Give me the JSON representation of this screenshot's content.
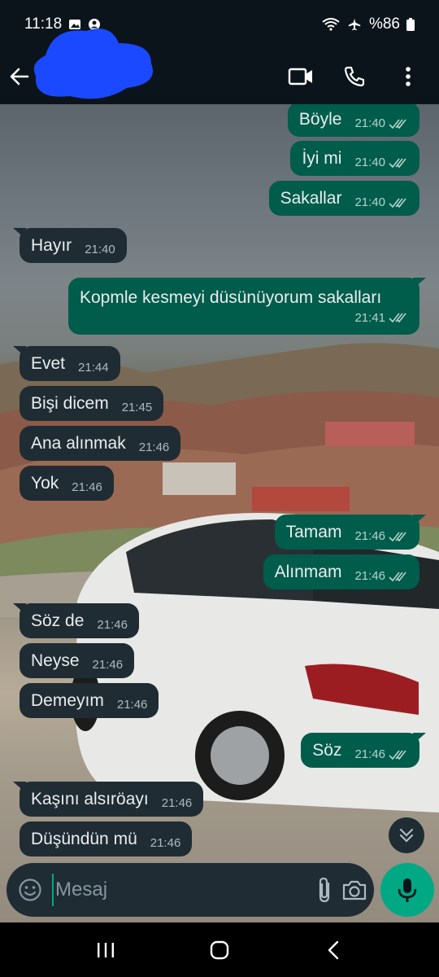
{
  "status": {
    "time": "11:18",
    "battery": "%86"
  },
  "header": {
    "contact_name": "",
    "icons": [
      "back-arrow-icon",
      "video-call-icon",
      "voice-call-icon",
      "more-vertical-icon"
    ]
  },
  "messages": [
    {
      "dir": "out",
      "text": "Böyle",
      "time": "21:40"
    },
    {
      "dir": "out",
      "text": "İyi mi",
      "time": "21:40"
    },
    {
      "dir": "out",
      "text": "Sakallar",
      "time": "21:40"
    },
    {
      "dir": "in",
      "text": "Hayır",
      "time": "21:40"
    },
    {
      "dir": "out",
      "text": "Kopmle kesmeyi  düsünüyorum sakalları",
      "time": "21:41"
    },
    {
      "dir": "in",
      "text": "Evet",
      "time": "21:44"
    },
    {
      "dir": "in",
      "text": "Bişi dicem",
      "time": "21:45"
    },
    {
      "dir": "in",
      "text": "Ana alınmak",
      "time": "21:46"
    },
    {
      "dir": "in",
      "text": "Yok",
      "time": "21:46"
    },
    {
      "dir": "out",
      "text": "Tamam",
      "time": "21:46"
    },
    {
      "dir": "out",
      "text": "Alınmam",
      "time": "21:46"
    },
    {
      "dir": "in",
      "text": "Söz de",
      "time": "21:46"
    },
    {
      "dir": "in",
      "text": "Neyse",
      "time": "21:46"
    },
    {
      "dir": "in",
      "text": "Demeyım",
      "time": "21:46"
    },
    {
      "dir": "out",
      "text": "Söz",
      "time": "21:46"
    },
    {
      "dir": "in",
      "text": "Kaşını alsıröayı",
      "time": "21:46"
    },
    {
      "dir": "in",
      "text": "Düşündün mü",
      "time": "21:46"
    }
  ],
  "composer": {
    "placeholder": "Mesaj"
  },
  "colors": {
    "incoming_bubble": "#202c33",
    "outgoing_bubble": "#005c4b",
    "accent": "#00a884",
    "header_bg": "#0b141a"
  }
}
